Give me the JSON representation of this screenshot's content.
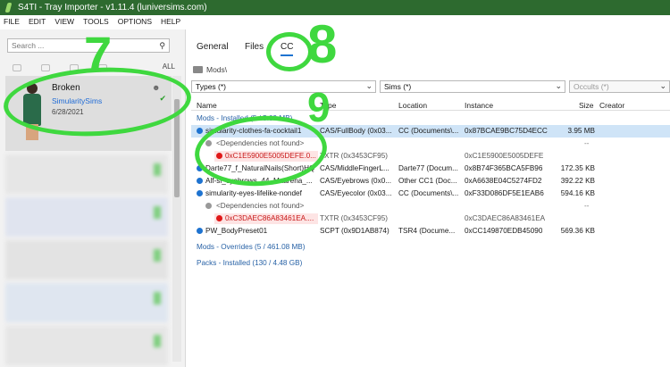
{
  "window": {
    "title": "S4TI - Tray Importer - v1.11.4  (luniversims.com)"
  },
  "menu": [
    "FILE",
    "EDIT",
    "VIEW",
    "TOOLS",
    "OPTIONS",
    "HELP"
  ],
  "sidebar": {
    "search_placeholder": "Search ...",
    "filter_all": "ALL",
    "selected_item": {
      "name": "Broken",
      "creator": "SimularitySims",
      "date": "6/28/2021"
    }
  },
  "tabs": [
    "General",
    "Files",
    "CC"
  ],
  "breadcrumb": "Mods\\",
  "filters": {
    "types": "Types (*)",
    "sims": "Sims (*)",
    "occults": "Occults (*)"
  },
  "columns": [
    "Name",
    "Type",
    "Location",
    "Instance",
    "Size",
    "Creator"
  ],
  "rows": [
    {
      "kind": "group",
      "name": "Mods - Installed  (5 / 5.09 MB)"
    },
    {
      "kind": "item",
      "dot": "blue",
      "name": "simularity-clothes-fa-cocktail1",
      "type": "CAS/FullBody (0x03...",
      "location": "CC (Documents\\...",
      "instance": "0x87BCAE9BC75D4ECC",
      "size": "3.95 MB",
      "selected": true
    },
    {
      "kind": "dep",
      "dot": "gray",
      "name": "<Dependencies not found>",
      "type": "",
      "location": "",
      "instance": "",
      "size": "--"
    },
    {
      "kind": "missing",
      "dot": "red",
      "name": "0xC1E5900E5005DEFE.0...",
      "type": "TXTR (0x3453CF95)",
      "location": "",
      "instance": "0xC1E5900E5005DEFE",
      "size": ""
    },
    {
      "kind": "item",
      "dot": "blue",
      "name": "Darte77_f_NaturalNails(Short)HQ",
      "type": "CAS/MiddleFingerL...",
      "location": "Darte77 (Docum...",
      "instance": "0x8B74F365BCA5FB96",
      "size": "172.35 KB"
    },
    {
      "kind": "item",
      "dot": "blue",
      "name": "Alf-si_eyebrows_44_Maarena_...",
      "type": "CAS/Eyebrows (0x0...",
      "location": "Other CC1 (Doc...",
      "instance": "0xA6638E04C5274FD2",
      "size": "392.22 KB"
    },
    {
      "kind": "item",
      "dot": "blue",
      "name": "simularity-eyes-lifelike-nondef",
      "type": "CAS/Eyecolor (0x03...",
      "location": "CC (Documents\\...",
      "instance": "0xF33D086DF5E1EAB6",
      "size": "594.16 KB"
    },
    {
      "kind": "dep",
      "dot": "gray",
      "name": "<Dependencies not found>",
      "type": "",
      "location": "",
      "instance": "",
      "size": "--"
    },
    {
      "kind": "missing",
      "dot": "red",
      "name": "0xC3DAEC86A83461EA....",
      "type": "TXTR (0x3453CF95)",
      "location": "",
      "instance": "0xC3DAEC86A83461EA",
      "size": ""
    },
    {
      "kind": "item",
      "dot": "blue",
      "name": "PW_BodyPreset01",
      "type": "SCPT (0x9D1AB874)",
      "location": "TSR4 (Docume...",
      "instance": "0xCC149870EDB45090",
      "size": "569.36 KB"
    },
    {
      "kind": "group",
      "name": "Mods - Overrides  (5 / 461.08 MB)"
    },
    {
      "kind": "group",
      "name": "Packs - Installed  (130 / 4.48 GB)"
    }
  ],
  "annotations": {
    "seven": "7",
    "eight": "8",
    "nine": "9"
  }
}
